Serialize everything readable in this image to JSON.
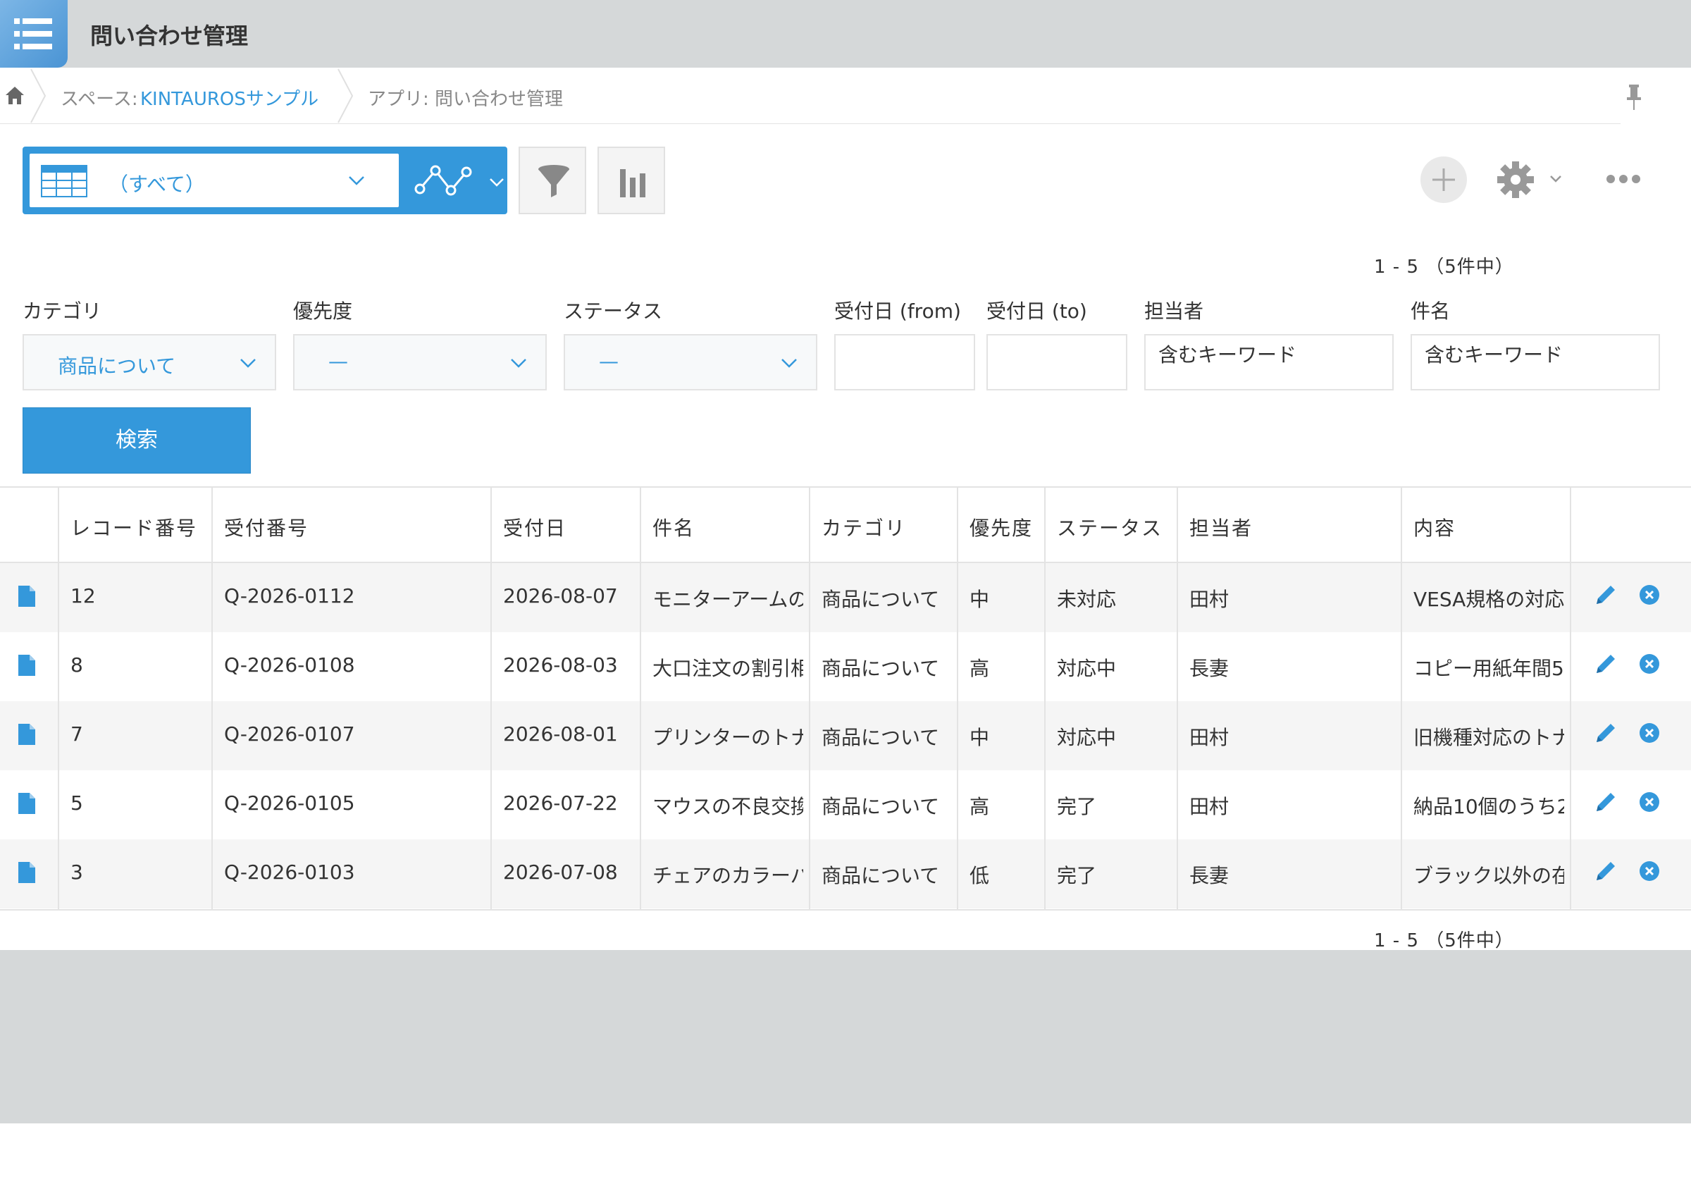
{
  "header": {
    "title": "問い合わせ管理"
  },
  "breadcrumb": {
    "space_label": "スペース: ",
    "space_name": "KINTAUROSサンプル",
    "app": "アプリ: 問い合わせ管理"
  },
  "toolbar": {
    "view_label": "（すべて）"
  },
  "pager": {
    "top": "1 - 5 （5件中）",
    "bottom": "1 - 5 （5件中）"
  },
  "filters": {
    "category": {
      "label": "カテゴリ",
      "value": "商品について"
    },
    "priority": {
      "label": "優先度",
      "value": "—"
    },
    "status": {
      "label": "ステータス",
      "value": "—"
    },
    "date_from": {
      "label": "受付日 (from)",
      "value": ""
    },
    "date_to": {
      "label": "受付日 (to)",
      "value": ""
    },
    "assignee": {
      "label": "担当者",
      "placeholder": "含むキーワード"
    },
    "subject": {
      "label": "件名",
      "placeholder": "含むキーワード"
    },
    "search_label": "検索"
  },
  "table": {
    "headers": [
      "レコード番号",
      "受付番号",
      "受付日",
      "件名",
      "カテゴリ",
      "優先度",
      "ステータス",
      "担当者",
      "内容"
    ],
    "rows": [
      {
        "record": "12",
        "receipt": "Q-2026-0112",
        "date": "2026-08-07",
        "subject": "モニターアームの",
        "category": "商品について",
        "priority": "中",
        "status": "未対応",
        "assignee": "田村",
        "content": "VESA規格の対応"
      },
      {
        "record": "8",
        "receipt": "Q-2026-0108",
        "date": "2026-08-03",
        "subject": "大口注文の割引相",
        "category": "商品について",
        "priority": "高",
        "status": "対応中",
        "assignee": "長妻",
        "content": "コピー用紙年間5"
      },
      {
        "record": "7",
        "receipt": "Q-2026-0107",
        "date": "2026-08-01",
        "subject": "プリンターのトナ",
        "category": "商品について",
        "priority": "中",
        "status": "対応中",
        "assignee": "田村",
        "content": "旧機種対応のトナ"
      },
      {
        "record": "5",
        "receipt": "Q-2026-0105",
        "date": "2026-07-22",
        "subject": "マウスの不良交換",
        "category": "商品について",
        "priority": "高",
        "status": "完了",
        "assignee": "田村",
        "content": "納品10個のうち2"
      },
      {
        "record": "3",
        "receipt": "Q-2026-0103",
        "date": "2026-07-08",
        "subject": "チェアのカラーバ",
        "category": "商品について",
        "priority": "低",
        "status": "完了",
        "assignee": "長妻",
        "content": "ブラック以外の在"
      }
    ]
  },
  "colors": {
    "accent": "#3498db",
    "header_bg": "#d5d8d9",
    "row_alt": "#f5f5f5"
  }
}
